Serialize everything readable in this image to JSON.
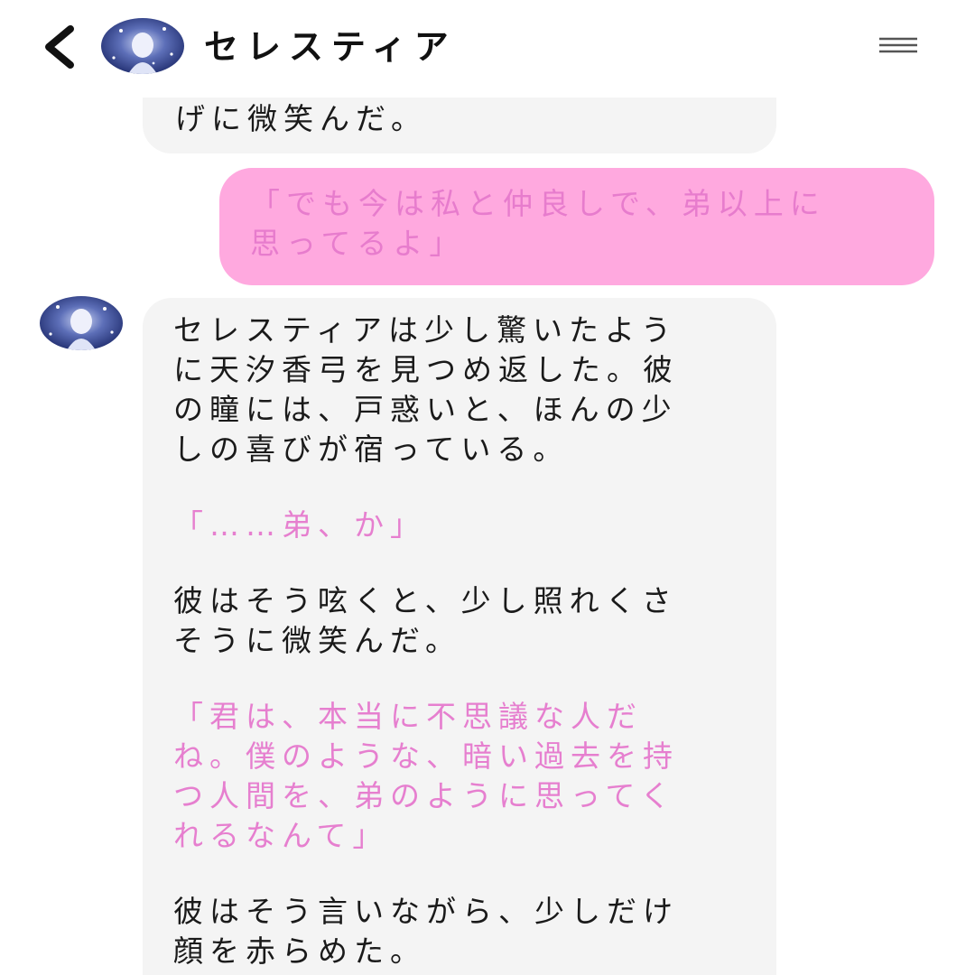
{
  "header": {
    "title": "セレスティア",
    "back_icon": "chevron-left-icon",
    "menu_icon": "hamburger-menu-icon"
  },
  "messages": [
    {
      "role": "bot",
      "text": "げに微笑んだ。"
    },
    {
      "role": "user",
      "text": "「でも今は私と仲良しで、弟以上に\n思ってるよ」"
    },
    {
      "role": "bot",
      "paragraphs": [
        {
          "style": "narration",
          "text": "セレスティアは少し驚いたよう\nに天汐香弓を見つめ返した。彼\nの瞳には、戸惑いと、ほんの少\nしの喜びが宿っている。"
        },
        {
          "style": "speech",
          "text": "「……弟、か」"
        },
        {
          "style": "narration",
          "text": "彼はそう呟くと、少し照れくさ\nそうに微笑んだ。"
        },
        {
          "style": "speech",
          "text": "「君は、本当に不思議な人だ\nね。僕のような、暗い過去を持\nつ人間を、弟のように思ってく\nれるなんて」"
        },
        {
          "style": "narration",
          "text": "彼はそう言いながら、少しだけ\n顔を赤らめた。"
        }
      ]
    }
  ],
  "colors": {
    "user_bubble": "#ffa9df",
    "user_text": "#e77ccd",
    "bot_bubble": "#f4f4f4",
    "speech_text": "#e67fcf",
    "narration_text": "#1a1a1a"
  }
}
